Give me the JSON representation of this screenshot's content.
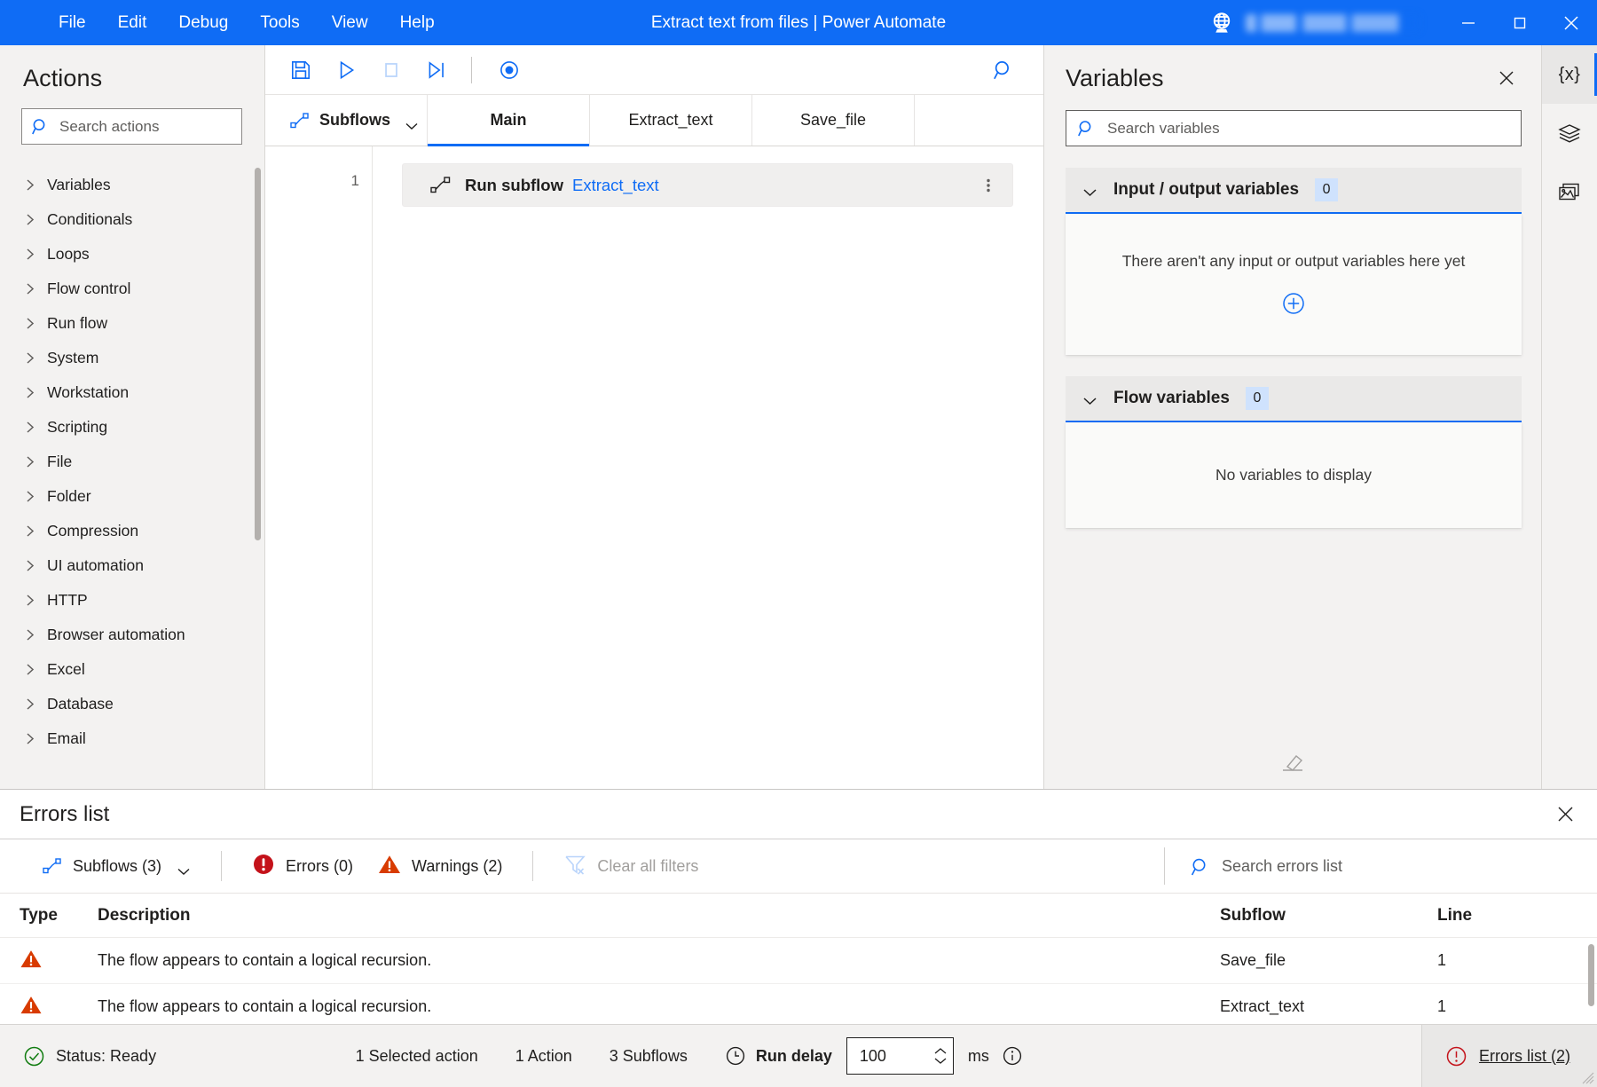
{
  "titlebar": {
    "menus": [
      "File",
      "Edit",
      "Debug",
      "Tools",
      "View",
      "Help"
    ],
    "title": "Extract text from files | Power Automate",
    "account_name": "",
    "globe_icon": "globe-icon",
    "minimize_icon": "minimize-icon",
    "maximize_icon": "maximize-icon",
    "close_icon": "close-icon"
  },
  "actions_pane": {
    "heading": "Actions",
    "search_placeholder": "Search actions",
    "search_value": "",
    "items": [
      "Variables",
      "Conditionals",
      "Loops",
      "Flow control",
      "Run flow",
      "System",
      "Workstation",
      "Scripting",
      "File",
      "Folder",
      "Compression",
      "UI automation",
      "HTTP",
      "Browser automation",
      "Excel",
      "Database",
      "Email"
    ]
  },
  "toolbar": {
    "save_label": "Save",
    "run_label": "Run",
    "stop_label": "Stop",
    "run_next_label": "Run next action",
    "recorder_label": "Recorder",
    "search_label": "Search"
  },
  "tabs": {
    "subflows_label": "Subflows",
    "items": [
      {
        "label": "Main",
        "active": true
      },
      {
        "label": "Extract_text",
        "active": false
      },
      {
        "label": "Save_file",
        "active": false
      }
    ]
  },
  "canvas": {
    "line_numbers": [
      "1"
    ],
    "steps": [
      {
        "label": "Run subflow",
        "argument": "Extract_text"
      }
    ]
  },
  "variables_pane": {
    "heading": "Variables",
    "search_placeholder": "Search variables",
    "search_value": "",
    "groups": [
      {
        "title": "Input / output variables",
        "count": "0",
        "empty_text": "There aren't any input or output variables here yet",
        "has_add": true
      },
      {
        "title": "Flow variables",
        "count": "0",
        "empty_text": "No variables to display",
        "has_add": false
      }
    ]
  },
  "rail": [
    {
      "name": "variables-icon",
      "glyph": "{x}",
      "active": true
    },
    {
      "name": "ui-elements-icon",
      "glyph": "",
      "active": false
    },
    {
      "name": "images-icon",
      "glyph": "",
      "active": false
    }
  ],
  "errors_panel": {
    "title": "Errors list",
    "subflows_filter": "Subflows (3)",
    "errors_filter": "Errors (0)",
    "warnings_filter": "Warnings (2)",
    "clear_filters": "Clear all filters",
    "search_placeholder": "Search errors list",
    "search_value": "",
    "columns": [
      "Type",
      "Description",
      "Subflow",
      "Line"
    ],
    "rows": [
      {
        "type": "warning",
        "description": "The flow appears to contain a logical recursion.",
        "subflow": "Save_file",
        "line": "1"
      },
      {
        "type": "warning",
        "description": "The flow appears to contain a logical recursion.",
        "subflow": "Extract_text",
        "line": "1"
      }
    ]
  },
  "statusbar": {
    "status": "Status: Ready",
    "selected_action": "1 Selected action",
    "action_count": "1 Action",
    "subflow_count": "3 Subflows",
    "run_delay_label": "Run delay",
    "run_delay_value": "100",
    "ms_label": "ms",
    "errors_link": "Errors list (2)"
  },
  "colors": {
    "accent": "#0f6cf5",
    "warning": "#d83b01",
    "error": "#c4121a",
    "success": "#107c10",
    "chrome": "#f3f2f1"
  }
}
